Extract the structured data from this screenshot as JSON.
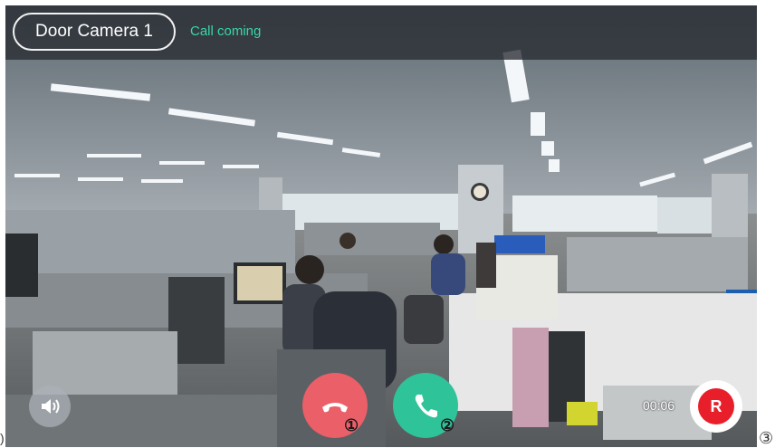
{
  "header": {
    "camera_name": "Door Camera 1",
    "status": "Call coming",
    "status_color": "#37d6a8"
  },
  "controls": {
    "speaker_icon": "speaker-icon",
    "hangup_icon": "phone-hangup-icon",
    "answer_icon": "phone-answer-icon",
    "record_label": "R",
    "timer": "00:06"
  },
  "callouts": {
    "one": "①",
    "two": "②",
    "three": "③",
    "left": ")"
  },
  "colors": {
    "hangup": "#ea5f68",
    "answer": "#2fc39a",
    "record": "#e81f2a"
  }
}
